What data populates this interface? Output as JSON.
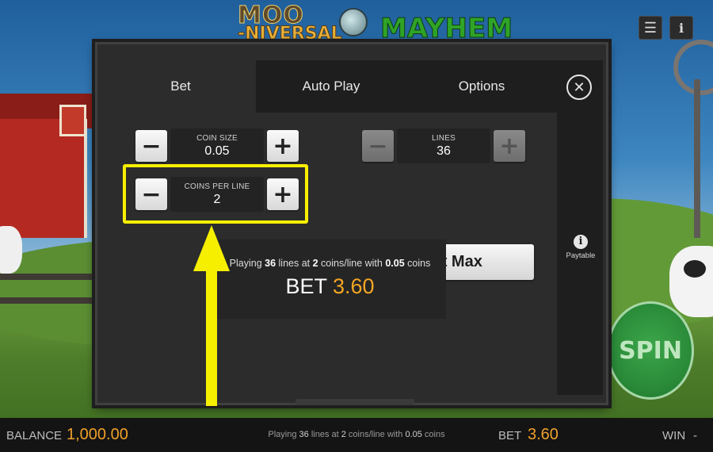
{
  "game": {
    "logo_line1": "MOO",
    "logo_line2": "-NIVERSAL",
    "logo_line3": "MAYHEM"
  },
  "top_controls": {
    "menu_icon": "hamburger-icon",
    "info_icon": "info-icon"
  },
  "modal": {
    "tabs": [
      {
        "label": "Bet",
        "active": true
      },
      {
        "label": "Auto Play",
        "active": false
      },
      {
        "label": "Options",
        "active": false
      }
    ],
    "close_icon": "close-icon",
    "coin_size": {
      "label": "COIN SIZE",
      "value": "0.05"
    },
    "coins_per_line": {
      "label": "COINS PER LINE",
      "value": "2"
    },
    "lines": {
      "label": "LINES",
      "value": "36"
    },
    "bet_max_label": "Bet Max",
    "summary": {
      "pre": "Playing ",
      "lines": "36",
      "mid1": " lines at ",
      "coins": "2",
      "mid2": " coins/line with ",
      "coin_size": "0.05",
      "post": " coins",
      "bet_label": "BET",
      "bet_value": "3.60"
    },
    "paytable_label": "Paytable"
  },
  "spin_label": "SPIN",
  "bottom_bar": {
    "balance_label": "BALANCE",
    "balance_value": "1,000.00",
    "info_pre": "Playing ",
    "info_lines": "36",
    "info_mid1": " lines at ",
    "info_coins": "2",
    "info_mid2": " coins/line with ",
    "info_coin_size": "0.05",
    "info_post": " coins",
    "bet_label": "BET",
    "bet_value": "3.60",
    "win_label": "WIN",
    "win_value": "-"
  },
  "colors": {
    "highlight": "#f7ef00",
    "bet_amount": "#f5a623",
    "modal_bg": "#2c2c2c",
    "spin_green": "#2f9a3f"
  }
}
